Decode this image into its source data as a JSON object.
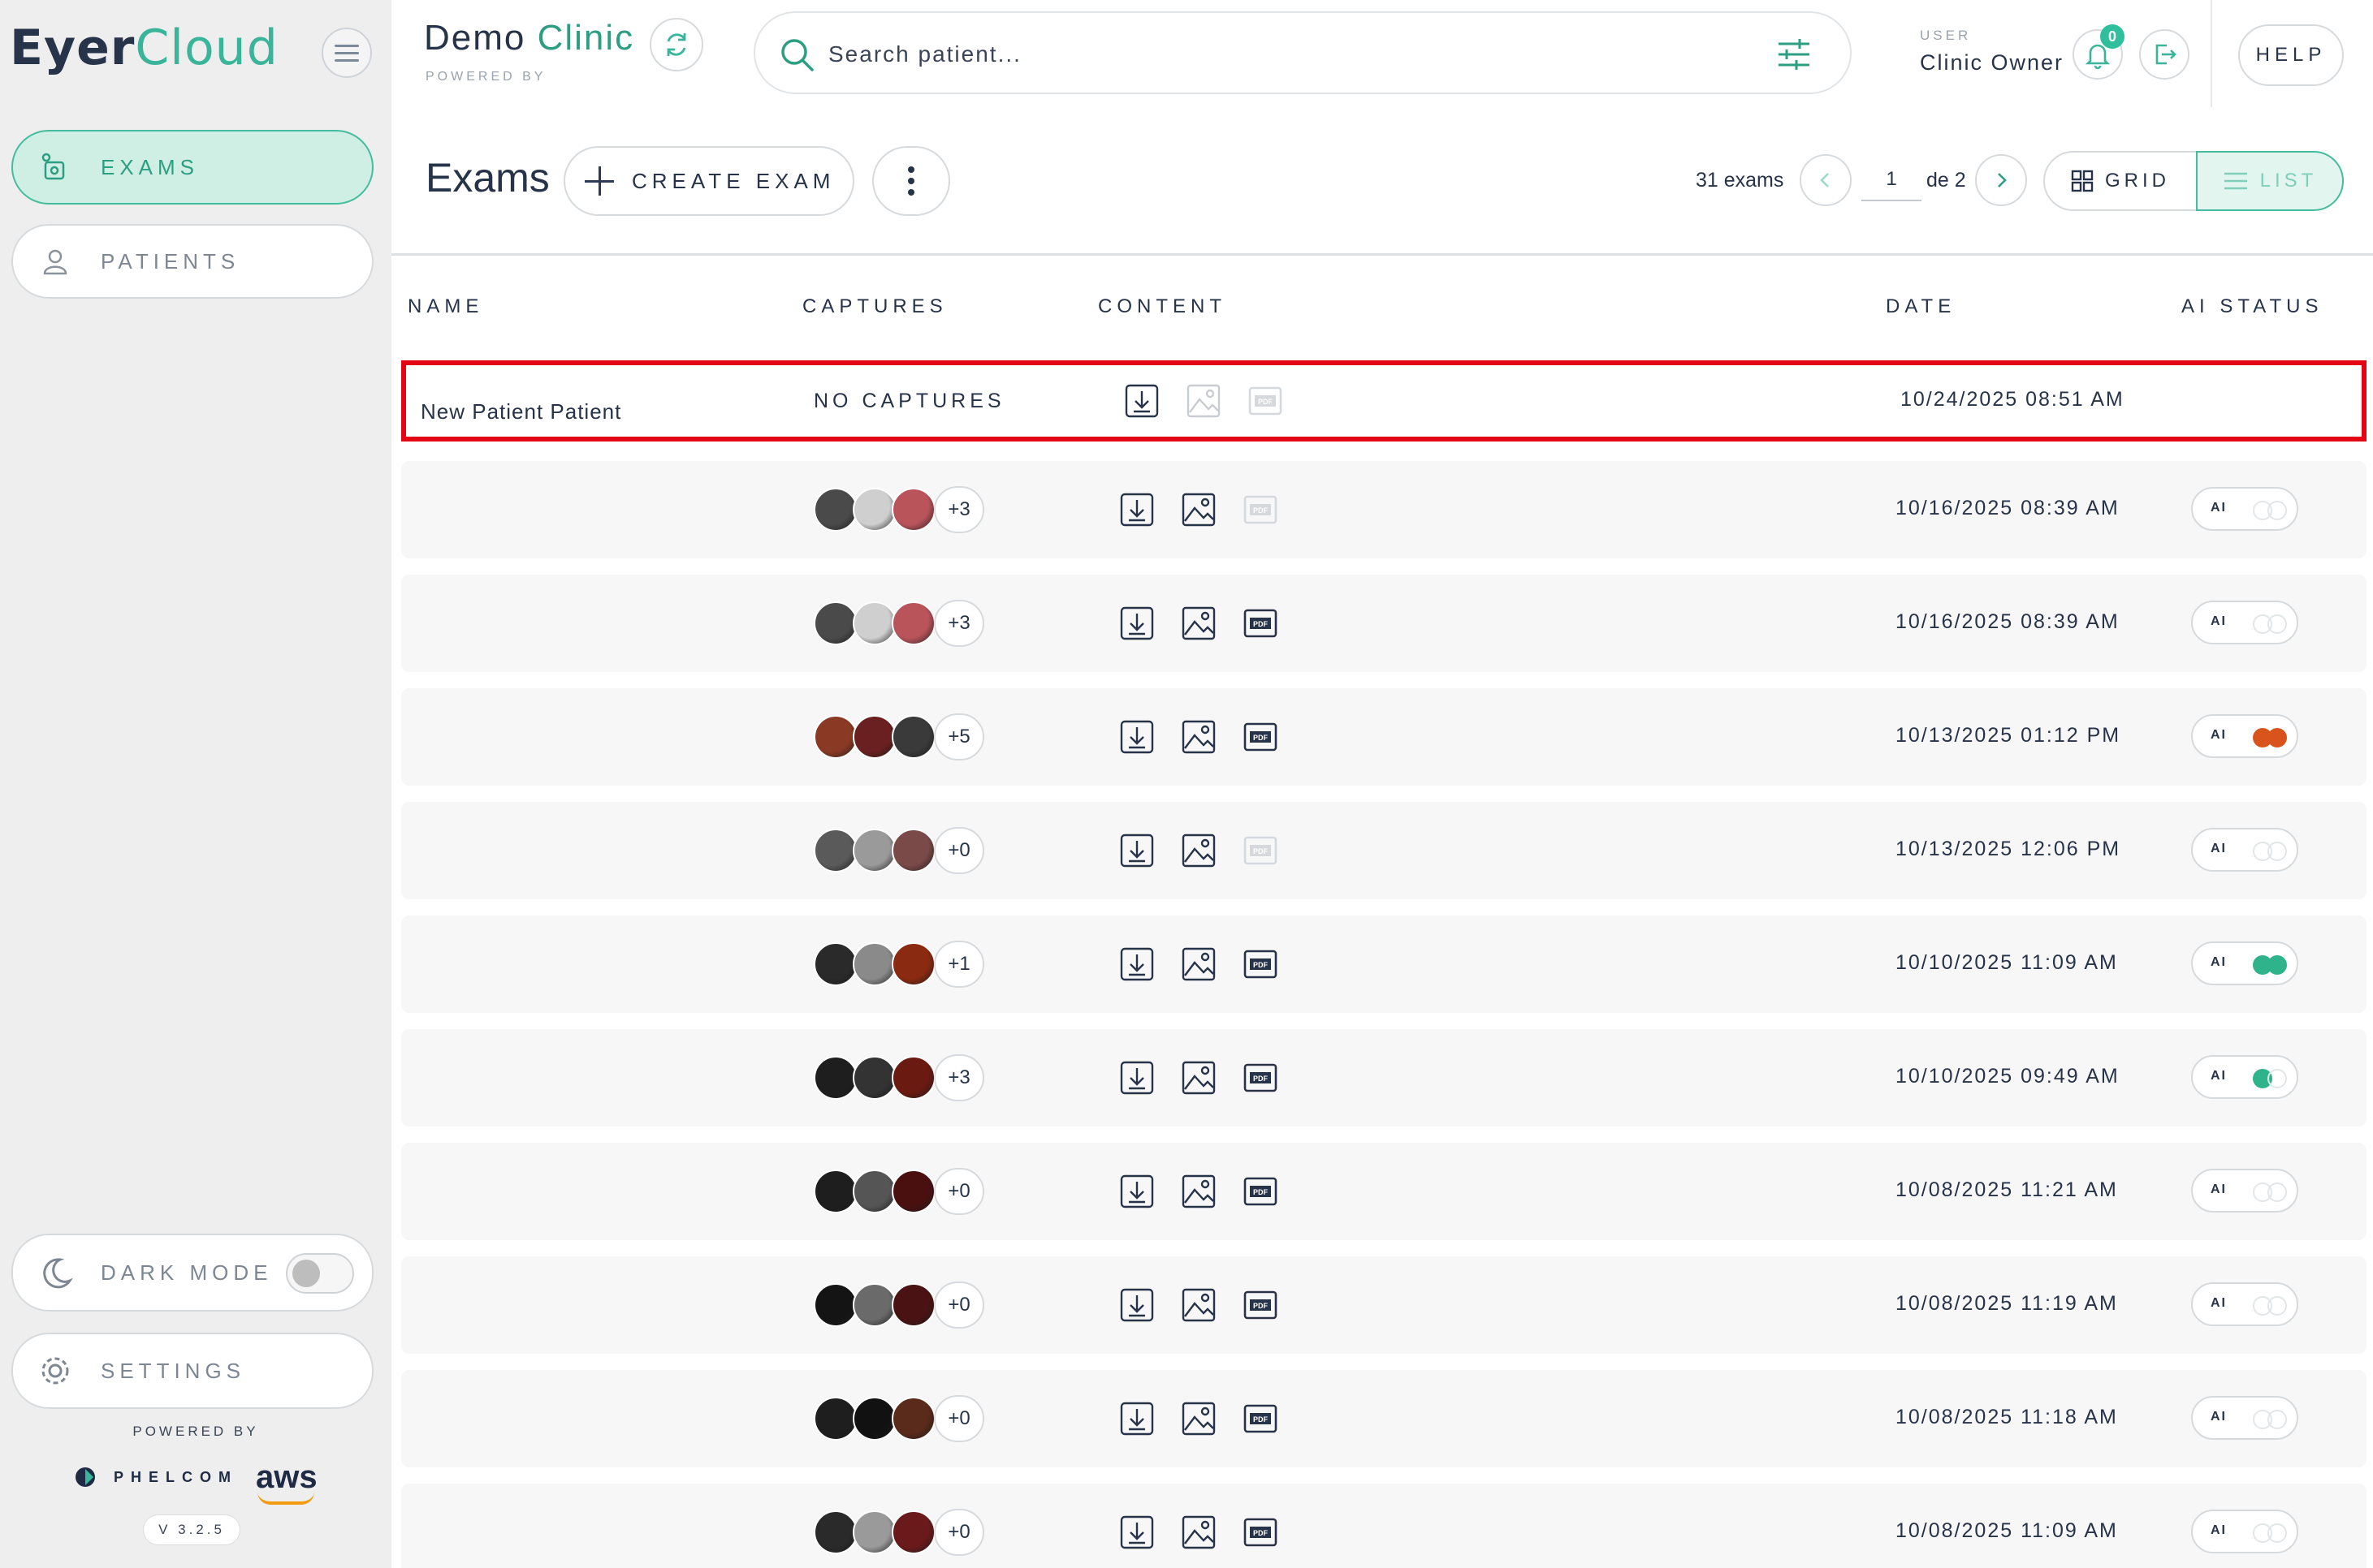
{
  "sidebar": {
    "logo_part1": "Eyer",
    "logo_part2": "Cloud",
    "nav": [
      {
        "label": "EXAMS",
        "icon": "exams-icon",
        "active": true
      },
      {
        "label": "PATIENTS",
        "icon": "patient-icon",
        "active": false
      }
    ],
    "dark_mode_label": "DARK MODE",
    "dark_mode_on": false,
    "settings_label": "SETTINGS",
    "powered_by": "POWERED BY",
    "brand_phelcom": "PHELCOM",
    "brand_aws": "aws",
    "version": "V 3.2.5"
  },
  "header": {
    "clinic_part1": "Demo",
    "clinic_part2": "Clinic",
    "powered_by": "POWERED BY",
    "search_placeholder": "Search patient...",
    "user_label": "USER",
    "user_name": "Clinic Owner",
    "notifications_count": "0",
    "help_label": "HELP"
  },
  "toolbar": {
    "title": "Exams",
    "create_label": "CREATE EXAM",
    "exam_count": "31 exams",
    "current_page": "1",
    "page_of": "de 2",
    "grid_label": "GRID",
    "list_label": "LIST"
  },
  "table": {
    "columns": [
      "NAME",
      "CAPTURES",
      "CONTENT",
      "DATE",
      "AI STATUS"
    ],
    "rows": [
      {
        "name": "New Patient Patient",
        "captures_text": "NO CAPTURES",
        "thumbs": [],
        "more": "",
        "image_enabled": false,
        "pdf_enabled": false,
        "date": "10/24/2025 08:51 AM",
        "ai": "none",
        "selected": true
      },
      {
        "name": "",
        "captures_text": "",
        "thumbs": [
          "#4a4a4a",
          "#cfcfcf",
          "#b8545a"
        ],
        "more": "+3",
        "image_enabled": true,
        "pdf_enabled": false,
        "date": "10/16/2025 08:39 AM",
        "ai": "off",
        "selected": false
      },
      {
        "name": "",
        "captures_text": "",
        "thumbs": [
          "#4a4a4a",
          "#cfcfcf",
          "#b8545a"
        ],
        "more": "+3",
        "image_enabled": true,
        "pdf_enabled": true,
        "date": "10/16/2025 08:39 AM",
        "ai": "off",
        "selected": false
      },
      {
        "name": "",
        "captures_text": "",
        "thumbs": [
          "#8a3a24",
          "#6a2020",
          "#3a3a3a"
        ],
        "more": "+5",
        "image_enabled": true,
        "pdf_enabled": true,
        "date": "10/13/2025 01:12 PM",
        "ai": "orange",
        "selected": false
      },
      {
        "name": "",
        "captures_text": "",
        "thumbs": [
          "#5a5a5a",
          "#9a9a9a",
          "#7a4a48"
        ],
        "more": "+0",
        "image_enabled": true,
        "pdf_enabled": false,
        "date": "10/13/2025 12:06 PM",
        "ai": "off",
        "selected": false
      },
      {
        "name": "",
        "captures_text": "",
        "thumbs": [
          "#2a2a2a",
          "#8a8a8a",
          "#8a2a10"
        ],
        "more": "+1",
        "image_enabled": true,
        "pdf_enabled": true,
        "date": "10/10/2025 11:09 AM",
        "ai": "green",
        "selected": false
      },
      {
        "name": "",
        "captures_text": "",
        "thumbs": [
          "#1e1e1e",
          "#333333",
          "#6a1a10"
        ],
        "more": "+3",
        "image_enabled": true,
        "pdf_enabled": true,
        "date": "10/10/2025 09:49 AM",
        "ai": "green-half",
        "selected": false
      },
      {
        "name": "",
        "captures_text": "",
        "thumbs": [
          "#1e1e1e",
          "#555555",
          "#4a1010"
        ],
        "more": "+0",
        "image_enabled": true,
        "pdf_enabled": true,
        "date": "10/08/2025 11:21 AM",
        "ai": "off",
        "selected": false
      },
      {
        "name": "",
        "captures_text": "",
        "thumbs": [
          "#141414",
          "#6a6a6a",
          "#4a1212"
        ],
        "more": "+0",
        "image_enabled": true,
        "pdf_enabled": true,
        "date": "10/08/2025 11:19 AM",
        "ai": "off",
        "selected": false
      },
      {
        "name": "",
        "captures_text": "",
        "thumbs": [
          "#1e1e1e",
          "#111111",
          "#5a2a1a"
        ],
        "more": "+0",
        "image_enabled": true,
        "pdf_enabled": true,
        "date": "10/08/2025 11:18 AM",
        "ai": "off",
        "selected": false
      },
      {
        "name": "",
        "captures_text": "",
        "thumbs": [
          "#2a2a2a",
          "#9a9a9a",
          "#6a1a1a"
        ],
        "more": "+0",
        "image_enabled": true,
        "pdf_enabled": true,
        "date": "10/08/2025 11:09 AM",
        "ai": "off",
        "selected": false
      }
    ]
  },
  "colors": {
    "accent": "#3bb59a",
    "selection_outline": "#e30613",
    "ai_orange": "#d9541c",
    "ai_green": "#2fb38a"
  }
}
